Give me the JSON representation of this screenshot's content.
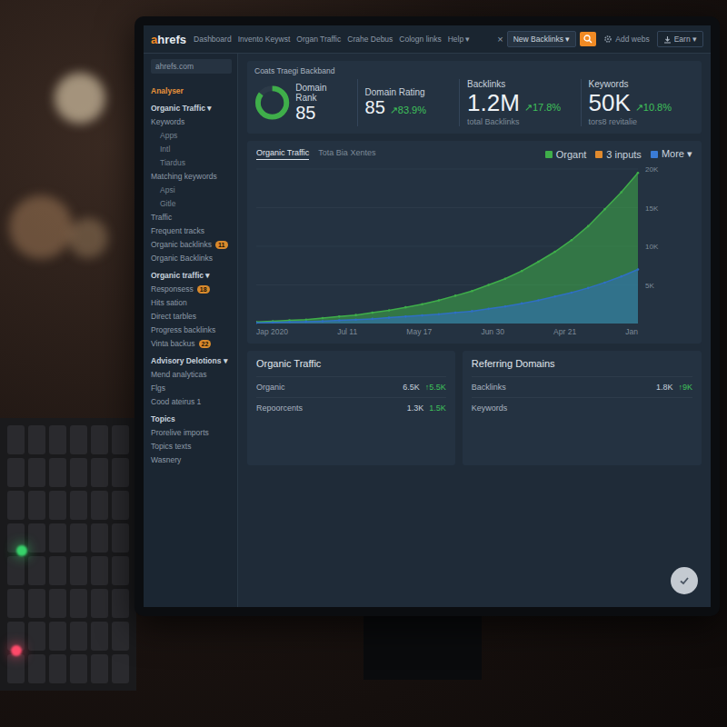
{
  "app": {
    "logo_accent": "a",
    "logo_rest": "hrefs",
    "site": "ahrefs.com"
  },
  "nav": {
    "items": [
      "Dashboard",
      "Invento Keywst",
      "Organ Traffic",
      "Crahe Debus",
      "Cologn links",
      "Help ▾"
    ],
    "clear": "×",
    "search": "New Backlinks ▾",
    "add": "Add webs",
    "export": "Earn ▾"
  },
  "sidebar": {
    "items": [
      {
        "label": "Analyser",
        "kind": "section",
        "selected": true
      },
      {
        "label": "Organic Traffic ▾",
        "kind": "section",
        "selected": false
      },
      {
        "label": "Keywords",
        "kind": "item",
        "selected": false
      },
      {
        "label": "Apps",
        "kind": "sub",
        "selected": false
      },
      {
        "label": "Intl",
        "kind": "sub",
        "selected": false
      },
      {
        "label": "Tiardus",
        "kind": "sub",
        "selected": false
      },
      {
        "label": "Matching keywords",
        "kind": "item",
        "selected": false
      },
      {
        "label": "Apsi",
        "kind": "sub",
        "selected": false
      },
      {
        "label": "Gitle",
        "kind": "sub",
        "selected": false
      },
      {
        "label": "Traffic",
        "kind": "item",
        "selected": false
      },
      {
        "label": "Frequent tracks",
        "kind": "item",
        "selected": false
      },
      {
        "label": "Organic backlinks",
        "kind": "item",
        "selected": false,
        "badge": "11"
      },
      {
        "label": "Organic Backlinks",
        "kind": "item",
        "selected": false
      },
      {
        "label": "Organic traffic ▾",
        "kind": "section",
        "selected": false
      },
      {
        "label": "Responsess",
        "kind": "item",
        "selected": false,
        "badge": "18"
      },
      {
        "label": "Hits sation",
        "kind": "item",
        "selected": false
      },
      {
        "label": "Direct tarbles",
        "kind": "item",
        "selected": false
      },
      {
        "label": "Progress backlinks",
        "kind": "item",
        "selected": false
      },
      {
        "label": "Vinta backus",
        "kind": "item",
        "selected": false,
        "badge": "22"
      },
      {
        "label": "Advisory Delotions ▾",
        "kind": "section",
        "selected": false
      },
      {
        "label": "Mend analyticas",
        "kind": "item",
        "selected": false
      },
      {
        "label": "Flgs",
        "kind": "item",
        "selected": false
      },
      {
        "label": "Cood ateirus 1",
        "kind": "item",
        "selected": false
      },
      {
        "label": "Topics",
        "kind": "section",
        "selected": false
      },
      {
        "label": "Prorelive imports",
        "kind": "item",
        "selected": false
      },
      {
        "label": "Topics texts",
        "kind": "item",
        "selected": false
      },
      {
        "label": "Wasnery",
        "kind": "item",
        "selected": false
      }
    ]
  },
  "breadcrumb": "Coats Traegi Backband",
  "stats": [
    {
      "kind": "donut",
      "label": "Domain Rank",
      "value": "85",
      "level": 0.85
    },
    {
      "kind": "change",
      "label": "Domain Rating",
      "value": "85",
      "change": "↗83.9%"
    },
    {
      "kind": "detail",
      "label": "Backlinks",
      "value": "1.2M",
      "change": "↗17.8%",
      "sub": "total Backlinks"
    },
    {
      "kind": "detail",
      "label": "Keywords",
      "value": "50K",
      "change": "↗10.8%",
      "sub": "tors8 revitalie"
    }
  ],
  "chart": {
    "tabs": [
      {
        "label": "Organic Traffic",
        "selected": true
      },
      {
        "label": "Tota Bia Xentes",
        "selected": false
      }
    ],
    "legend": [
      {
        "label": "Organt",
        "color": "#3fae4a"
      },
      {
        "label": "3 inputs",
        "color": "#e08a2e"
      },
      {
        "label": "More ▾",
        "color": "#3a7bd5"
      }
    ],
    "y_ticks": [
      "20K",
      "15K",
      "10K",
      "5K"
    ],
    "x_ticks": [
      "Jap 2020",
      "Jul 11",
      "May 17",
      "Jun 30",
      "Apr 21",
      "Jan"
    ],
    "series": [
      {
        "color": "#3fae4a",
        "values": [
          0.2,
          0.3,
          0.4,
          0.5,
          0.7,
          0.9,
          1.1,
          1.4,
          1.7,
          2.1,
          2.5,
          3.0,
          3.6,
          4.2,
          5.0,
          5.8,
          6.8,
          8.0,
          9.3,
          10.8,
          12.6,
          14.8,
          17.0,
          19.5
        ]
      },
      {
        "color": "#2f6fc4",
        "values": [
          0.1,
          0.15,
          0.2,
          0.25,
          0.3,
          0.4,
          0.5,
          0.6,
          0.75,
          0.9,
          1.05,
          1.2,
          1.4,
          1.6,
          1.9,
          2.2,
          2.6,
          3.0,
          3.5,
          4.0,
          4.6,
          5.3,
          6.1,
          7.0
        ]
      }
    ]
  },
  "tables": [
    {
      "title": "Organic Traffic",
      "rows": [
        {
          "label": "Organic",
          "value": "6.5K",
          "change": "↑5.5K"
        },
        {
          "label": "Repoorcents",
          "value": "1.3K",
          "change": "1.5K"
        }
      ]
    },
    {
      "title": "Referring Domains",
      "rows": [
        {
          "label": "Backlinks",
          "value": "1.8K",
          "change": "↑9K"
        },
        {
          "label": "Keywords"
        }
      ]
    }
  ]
}
